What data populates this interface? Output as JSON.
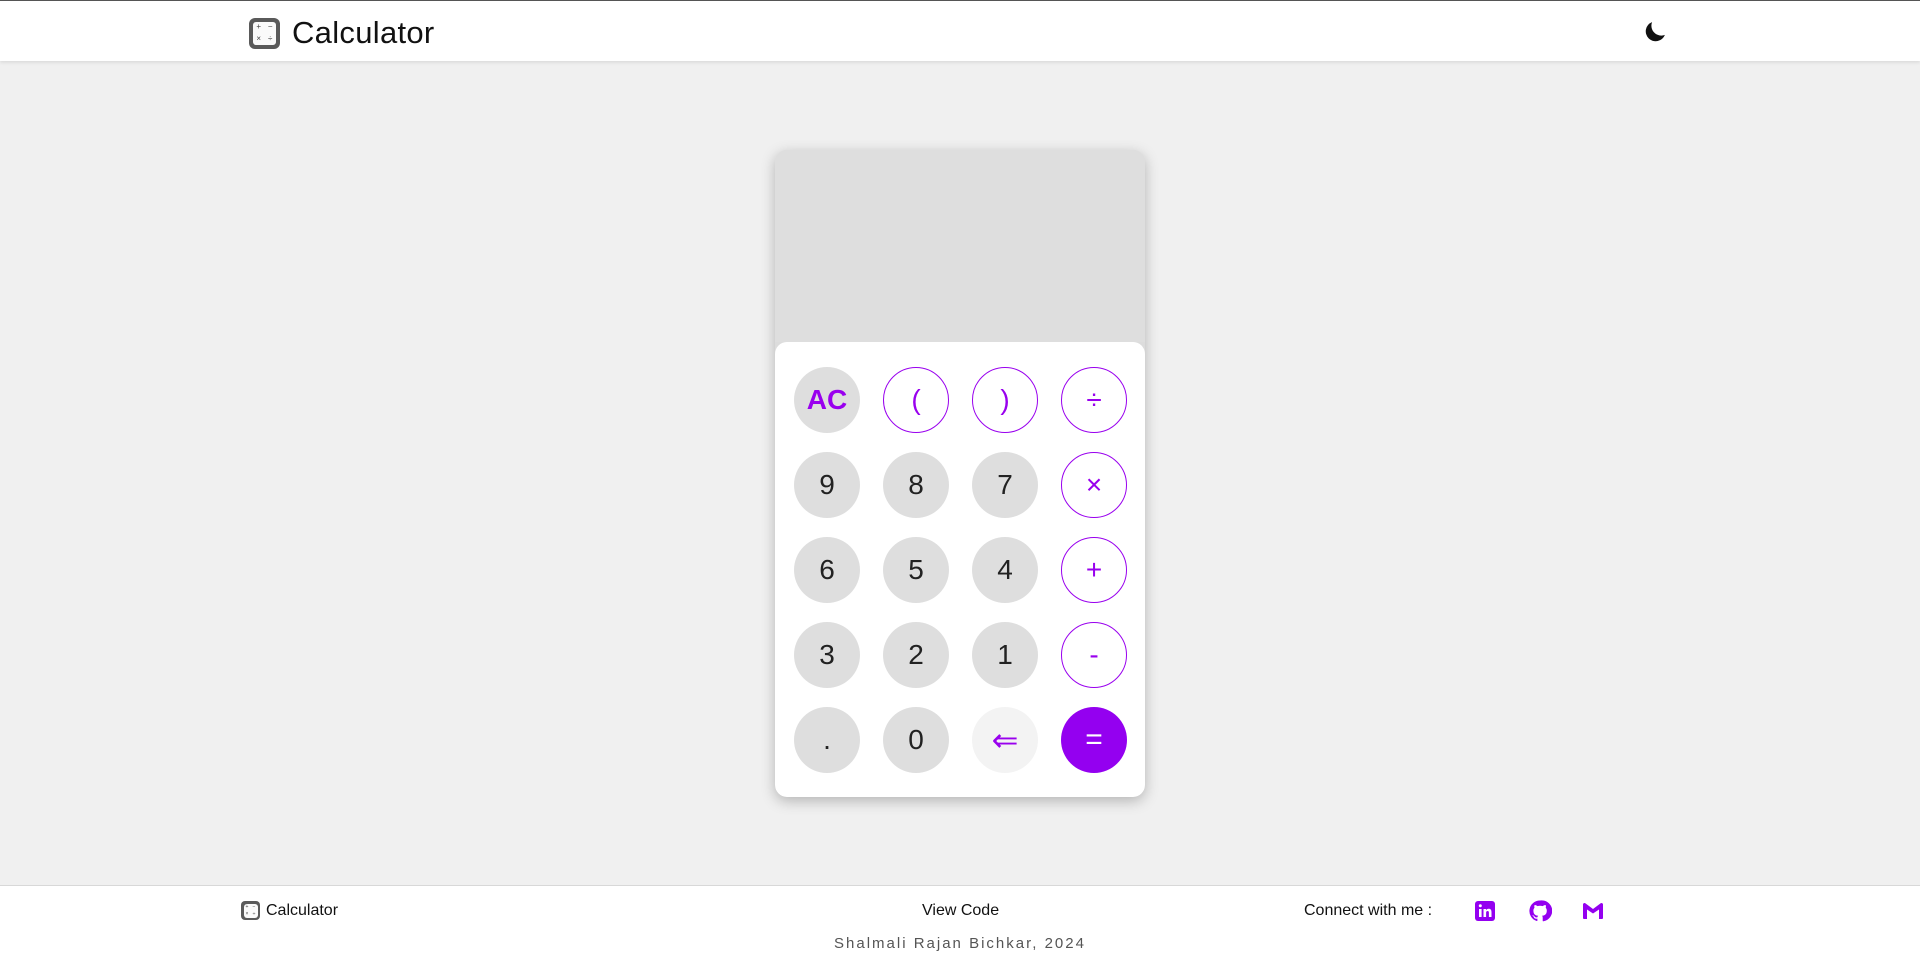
{
  "header": {
    "title": "Calculator",
    "app_icon": "calculator-app-icon",
    "theme_toggle_icon": "moon-icon"
  },
  "calculator": {
    "display_value": "",
    "keys": {
      "ac": "AC",
      "paren_open": "(",
      "paren_close": ")",
      "divide": "÷",
      "nine": "9",
      "eight": "8",
      "seven": "7",
      "multiply": "×",
      "six": "6",
      "five": "5",
      "four": "4",
      "plus": "+",
      "three": "3",
      "two": "2",
      "one": "1",
      "minus": "-",
      "dot": ".",
      "zero": "0",
      "backspace": "⇐",
      "equals": "="
    }
  },
  "footer": {
    "brand_label": "Calculator",
    "view_code": "View Code",
    "connect_label": "Connect with me :",
    "social_icons": [
      "linkedin-icon",
      "github-icon",
      "gmail-icon"
    ],
    "copyright": "Shalmali Rajan Bichkar, 2024"
  },
  "colors": {
    "accent": "#9400f0",
    "page_bg": "#f0f0f0",
    "key_bg": "#dedede"
  }
}
